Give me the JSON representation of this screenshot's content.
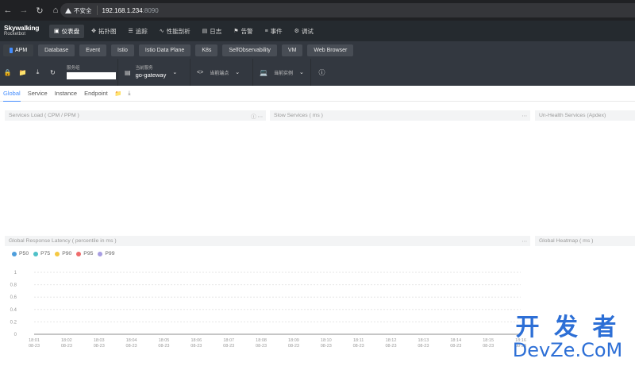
{
  "browser": {
    "nav_icons": [
      "back-icon",
      "forward-icon",
      "reload-icon",
      "home-icon"
    ],
    "security_label": "不安全",
    "url_host": "192.168.1.234",
    "url_port": ":8090"
  },
  "app": {
    "logo_line1": "Skywalking",
    "logo_line2": "Rocketbot",
    "nav": [
      {
        "icon": "dashboard-icon",
        "label": "仪表盘",
        "active": true
      },
      {
        "icon": "topology-icon",
        "label": "拓扑图"
      },
      {
        "icon": "trace-icon",
        "label": "追踪"
      },
      {
        "icon": "profile-icon",
        "label": "性能剖析"
      },
      {
        "icon": "log-icon",
        "label": "日志"
      },
      {
        "icon": "alarm-icon",
        "label": "告警"
      },
      {
        "icon": "event-icon",
        "label": "事件"
      },
      {
        "icon": "debug-icon",
        "label": "调试"
      }
    ]
  },
  "layers": [
    "APM",
    "Database",
    "Event",
    "Istio",
    "Istio Data Plane",
    "K8s",
    "SelfObservability",
    "VM",
    "Web Browser"
  ],
  "toolbar": {
    "service_group_caption": "服务组",
    "current_service_caption": "当前服务",
    "current_service_value": "go-gateway",
    "current_endpoint_caption": "当前端点",
    "current_instance_caption": "当前实例"
  },
  "subtabs": [
    "Global",
    "Service",
    "Instance",
    "Endpoint"
  ],
  "panels": {
    "services_load": "Services Load ( CPM / PPM )",
    "slow_services": "Slow Services ( ms )",
    "unhealth_services": "Un-Health Services (Apdex)",
    "response_latency": "Global Response Latency ( percentile in ms )",
    "heatmap": "Global Heatmap ( ms )"
  },
  "chart_data": {
    "type": "line",
    "title": "Global Response Latency ( percentile in ms )",
    "series": [
      {
        "name": "P50",
        "color": "#4e9edc",
        "values": [
          0,
          0,
          0,
          0,
          0,
          0,
          0,
          0,
          0,
          0,
          0,
          0,
          0,
          0,
          0,
          0
        ]
      },
      {
        "name": "P75",
        "color": "#4fc1c8",
        "values": [
          0,
          0,
          0,
          0,
          0,
          0,
          0,
          0,
          0,
          0,
          0,
          0,
          0,
          0,
          0,
          0
        ]
      },
      {
        "name": "P90",
        "color": "#f5c842",
        "values": [
          0,
          0,
          0,
          0,
          0,
          0,
          0,
          0,
          0,
          0,
          0,
          0,
          0,
          0,
          0,
          0
        ]
      },
      {
        "name": "P95",
        "color": "#ef6b6b",
        "values": [
          0,
          0,
          0,
          0,
          0,
          0,
          0,
          0,
          0,
          0,
          0,
          0,
          0,
          0,
          0,
          0
        ]
      },
      {
        "name": "P99",
        "color": "#a89ee2",
        "values": [
          0,
          0,
          0,
          0,
          0,
          0,
          0,
          0,
          0,
          0,
          0,
          0,
          0,
          0,
          0,
          0
        ]
      }
    ],
    "x": [
      "18:01",
      "18:02",
      "18:03",
      "18:04",
      "18:05",
      "18:06",
      "18:07",
      "18:08",
      "18:09",
      "18:10",
      "18:11",
      "18:12",
      "18:13",
      "18:14",
      "18:15",
      "18:16"
    ],
    "x_sub": "08-23",
    "yticks": [
      "1",
      "0.8",
      "0.6",
      "0.4",
      "0.2",
      "0"
    ],
    "ylim": [
      0,
      1
    ],
    "grid": true
  },
  "watermark": {
    "line1": "开 发 者",
    "line2": "DevZe.CoM"
  }
}
